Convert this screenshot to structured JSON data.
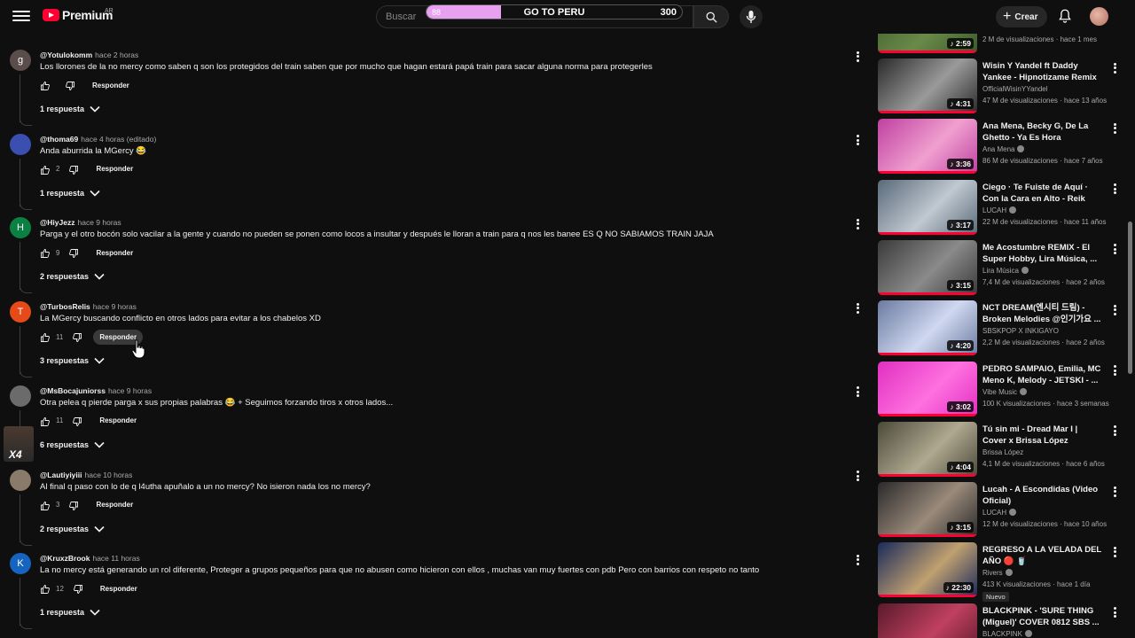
{
  "header": {
    "menu_icon": "hamburger-menu-icon",
    "logo_text": "Premium",
    "logo_country": "AR",
    "search_placeholder": "Buscar",
    "overlay": {
      "left_number": "88",
      "label": "GO TO PERU",
      "right_number": "300",
      "fill": 0.29,
      "fill_color": "#e8a0f0"
    },
    "create_label": "Crear"
  },
  "comments": [
    {
      "author": "@Yotulokomm",
      "time": "hace 2 horas",
      "text": "Los llorones de la no mercy como saben q son los protegidos del train saben que por mucho que hagan estará papá train para sacar alguna norma para protegerles",
      "likes": "",
      "reply_label": "Responder",
      "replies": "1 respuesta",
      "avatar_letter": "g",
      "avatar_color": "#5a4d4a"
    },
    {
      "author": "@thoma69",
      "time": "hace 4 horas (editado)",
      "text": "Anda aburrida la MGercy 😂",
      "likes": "2",
      "reply_label": "Responder",
      "replies": "1 respuesta",
      "avatar_letter": "",
      "avatar_color": "#3b4fb0"
    },
    {
      "author": "@HiyJezz",
      "time": "hace 9 horas",
      "text": "Parga y el otro bocón solo vacilar a la gente y cuando no pueden se ponen como locos a insultar y después le lloran a train para q nos les banee ES Q NO SABIAMOS TRAIN JAJA",
      "likes": "9",
      "reply_label": "Responder",
      "replies": "2 respuestas",
      "avatar_letter": "H",
      "avatar_color": "#0b8043"
    },
    {
      "author": "@TurbosRelis",
      "time": "hace 9 horas",
      "text": "La MGercy buscando conflicto en otros lados para evitar a los chabelos   XD",
      "likes": "11",
      "reply_label": "Responder",
      "replies": "3 respuestas",
      "avatar_letter": "T",
      "avatar_color": "#e64a19"
    },
    {
      "author": "@MsBocajuniorss",
      "time": "hace 9 horas",
      "text": "Otra pelea q pierde parga x sus propias palabras 😂 + Seguimos forzando tiros x otros lados...",
      "likes": "11",
      "reply_label": "Responder",
      "replies": "6 respuestas",
      "avatar_letter": "",
      "avatar_color": "#6b6b6b"
    },
    {
      "author": "@Lautiyiyiii",
      "time": "hace 10 horas",
      "text": "Al final q paso con lo de q l4utha apuñalo a un no mercy? No isieron nada los no mercy?",
      "likes": "3",
      "reply_label": "Responder",
      "replies": "2 respuestas",
      "avatar_letter": "",
      "avatar_color": "#8a7a6a"
    },
    {
      "author": "@KruxzBrook",
      "time": "hace 11 horas",
      "text": "La no mercy está generando un rol diferente, Proteger a grupos pequeños para que no abusen como hicieron con ellos , muchas van muy fuertes con pdb Pero con barrios con respeto no tanto",
      "likes": "12",
      "reply_label": "Responder",
      "replies": "1 respuesta",
      "avatar_letter": "K",
      "avatar_color": "#1565c0"
    }
  ],
  "side_avatar_text": "X4",
  "sidebar_videos": [
    {
      "title": "",
      "channel": "",
      "meta": "2 M de visualizaciones · hace 1 mes",
      "duration": "2:59",
      "thumb_colors": [
        "#3a5a2a",
        "#6a8a4a"
      ],
      "verified": false,
      "partial_top": true
    },
    {
      "title": "Wisin Y Yandel ft Daddy Yankee - Hipnotizame Remix ...",
      "channel": "OfficialWisinYYandel",
      "meta": "47 M de visualizaciones · hace 13 años",
      "duration": "4:31",
      "thumb_colors": [
        "#2a2a2a",
        "#9a9a9a"
      ],
      "verified": false
    },
    {
      "title": "Ana Mena, Becky G, De La Ghetto - Ya Es Hora",
      "channel": "Ana Mena",
      "meta": "86 M de visualizaciones · hace 7 años",
      "duration": "3:36",
      "thumb_colors": [
        "#c040a0",
        "#f0a0d0"
      ],
      "verified": true
    },
    {
      "title": "Ciego · Te Fuiste de Aquí · Con la Cara en Alto - Reik (Cover d...",
      "channel": "LUCAH",
      "meta": "22 M de visualizaciones · hace 11 años",
      "duration": "3:17",
      "thumb_colors": [
        "#5a6a7a",
        "#c0c8d0"
      ],
      "verified": true
    },
    {
      "title": "Me Acostumbre REMIX - El Super Hobby, Lira Música, ...",
      "channel": "Lira Música",
      "meta": "7,4 M de visualizaciones · hace 2 años",
      "duration": "3:15",
      "thumb_colors": [
        "#3a3a3a",
        "#8a8a8a"
      ],
      "verified": true
    },
    {
      "title": "NCT DREAM(엔시티 드림) - Broken Melodies @인기가요 ...",
      "channel": "SBSKPOP X INKIGAYO",
      "meta": "2,2 M de visualizaciones · hace 2 años",
      "duration": "4:20",
      "thumb_colors": [
        "#6a7aa0",
        "#d0d8f0"
      ],
      "verified": false
    },
    {
      "title": "PEDRO SAMPAIO, Emilia, MC Meno K, Melody - JETSKI - ...",
      "channel": "Vibe Music",
      "meta": "100 K visualizaciones · hace 3 semanas",
      "duration": "3:02",
      "thumb_colors": [
        "#e030c0",
        "#ff70e0"
      ],
      "verified": true
    },
    {
      "title": "Tú sin mi - Dread Mar I | Cover x Brissa López",
      "channel": "Brissa López",
      "meta": "4,1 M de visualizaciones · hace 6 años",
      "duration": "4:04",
      "thumb_colors": [
        "#4a4a3a",
        "#b0a890"
      ],
      "verified": false
    },
    {
      "title": "Lucah - A Escondidas (Video Oficial)",
      "channel": "LUCAH",
      "meta": "12 M de visualizaciones · hace 10 años",
      "duration": "3:15",
      "thumb_colors": [
        "#2a2a2a",
        "#9a8a7a"
      ],
      "verified": true
    },
    {
      "title": "REGRESO A LA VELADA DEL AÑO 🔴 🥤",
      "channel": "Rivers",
      "meta": "413 K visualizaciones · hace 1 día",
      "duration": "22:30",
      "thumb_colors": [
        "#1a2a5a",
        "#c0a070"
      ],
      "verified": true,
      "badge": "Nuevo"
    },
    {
      "title": "BLACKPINK - 'SURE THING (Miguel)' COVER 0812 SBS ...",
      "channel": "BLACKPINK",
      "meta": "",
      "duration": "",
      "thumb_colors": [
        "#5a1a2a",
        "#c04060"
      ],
      "verified": true
    }
  ]
}
